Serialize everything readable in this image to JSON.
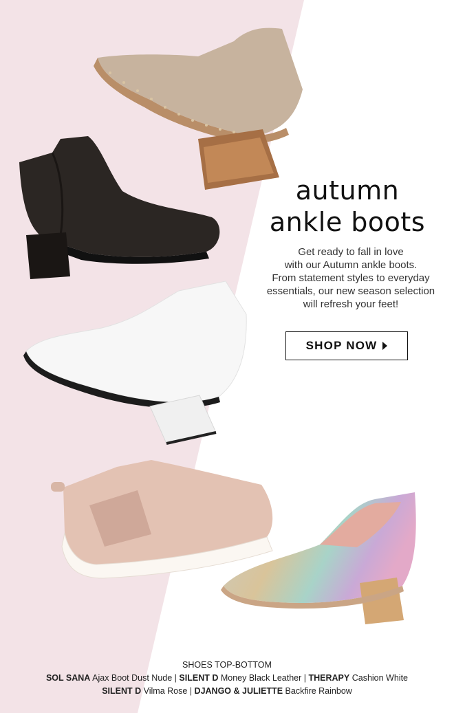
{
  "headline": {
    "line1": "autumn",
    "line2": "ankle boots"
  },
  "intro": {
    "line1": "Get ready to fall in love",
    "line2": "with our Autumn ankle boots.",
    "line3": "From statement styles to everyday",
    "line4": "essentials, our new season selection",
    "line5": "will refresh your feet!"
  },
  "cta": {
    "label": "SHOP NOW",
    "icon": "caret-right-icon"
  },
  "credits": {
    "heading": "SHOES TOP-BOTTOM",
    "items": [
      {
        "brand": "SOL SANA",
        "product": "Ajax Boot Dust Nude"
      },
      {
        "brand": "SILENT D",
        "product": "Money Black Leather"
      },
      {
        "brand": "THERAPY",
        "product": "Cashion White"
      },
      {
        "brand": "SILENT D",
        "product": "Vilma Rose"
      },
      {
        "brand": "DJANGO & JULIETTE",
        "product": "Backfire Rainbow"
      }
    ],
    "separator": "|"
  },
  "colors": {
    "background_pink": "#f3e3e7",
    "background_white": "#ffffff",
    "text": "#111111"
  }
}
